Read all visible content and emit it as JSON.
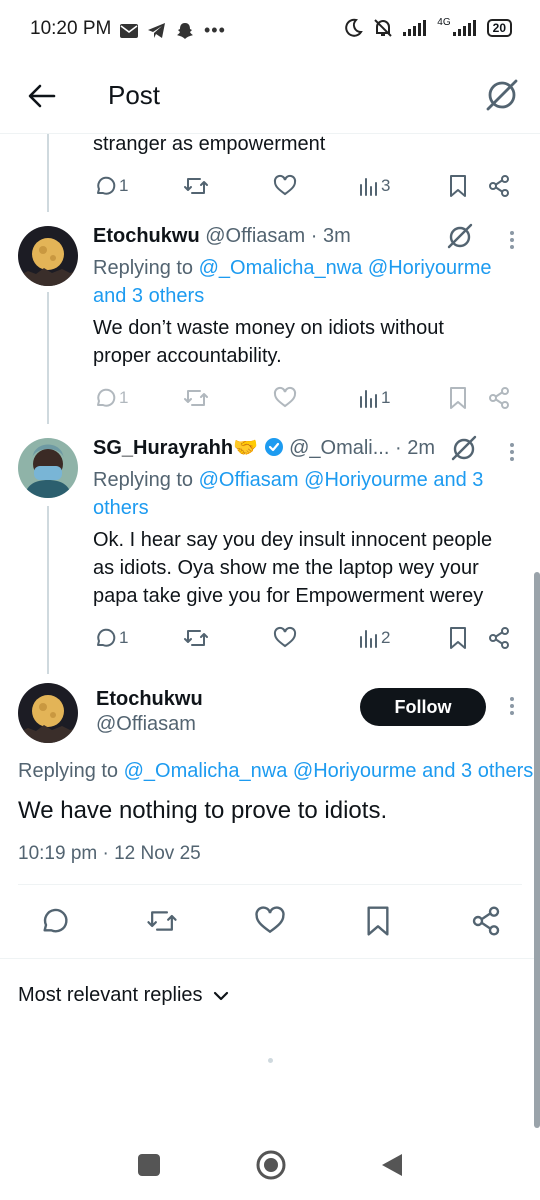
{
  "status_bar": {
    "time": "10:20 PM",
    "network": "4G",
    "battery": "20"
  },
  "header": {
    "title": "Post"
  },
  "prev_tweet": {
    "text_tail": "stranger as empowerment",
    "replies": "1",
    "views": "3"
  },
  "tweets": [
    {
      "name": "Etochukwu",
      "handle": "@Offiasam",
      "time": "· 3m",
      "replying_prefix": "Replying to",
      "replying_line1": "@_Omalicha_nwa @Horiyourme",
      "replying_line2": "and 3 others",
      "text_line1": "We don’t waste money on idiots without",
      "text_line2": "proper accountability.",
      "replies": "1",
      "views": "1"
    },
    {
      "name": "SG_Hurayrahh",
      "badge": "🤝",
      "handle": "@_Omali...",
      "time": "· 2m",
      "replying_prefix": "Replying to",
      "replying_line1": "@Offiasam @Horiyourme and 3",
      "replying_line2": "others",
      "text_line1": "Ok. I hear say you dey insult innocent people",
      "text_line2": "as idiots. Oya show me the laptop wey your",
      "text_line3": "papa take give you for Empowerment werey",
      "replies": "1",
      "views": "2"
    }
  ],
  "main_tweet": {
    "name": "Etochukwu",
    "handle": "@Offiasam",
    "follow_label": "Follow",
    "replying_prefix": "Replying to",
    "replying_mentions": "@_Omalicha_nwa @Horiyourme and 3 others",
    "text": "We have nothing to prove to idiots.",
    "timestamp": "10:19 pm · 12 Nov 25"
  },
  "replies_filter": {
    "label": "Most relevant replies"
  },
  "colors": {
    "accent": "#1d9bf0",
    "text": "#0f1419",
    "muted": "#536471",
    "verified": "#1d9bf0"
  }
}
